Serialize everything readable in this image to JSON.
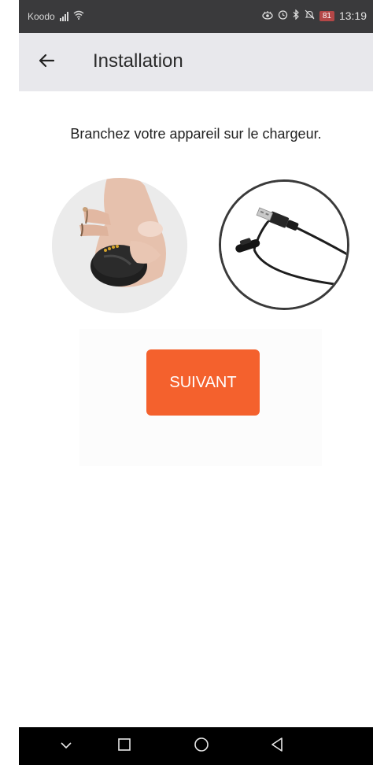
{
  "status_bar": {
    "carrier": "Koodo",
    "battery": "81",
    "time": "13:19",
    "icons": [
      "signal-icon",
      "wifi-icon",
      "eye-icon",
      "alarm-icon",
      "bluetooth-icon",
      "mute-icon",
      "battery-icon"
    ]
  },
  "app_bar": {
    "title": "Installation",
    "back_icon": "arrow-left-icon"
  },
  "main": {
    "instruction": "Branchez votre appareil sur le chargeur.",
    "images": [
      "device-in-hand-photo",
      "charging-cable-photo"
    ],
    "next_button": "SUIVANT"
  },
  "nav_bar": {
    "icons": [
      "chevron-down-icon",
      "square-icon",
      "circle-icon",
      "triangle-back-icon"
    ]
  },
  "colors": {
    "status_bar": "#3a3a3c",
    "app_bar": "#e8e8ec",
    "accent": "#f4612d",
    "nav_bar": "#000000"
  }
}
